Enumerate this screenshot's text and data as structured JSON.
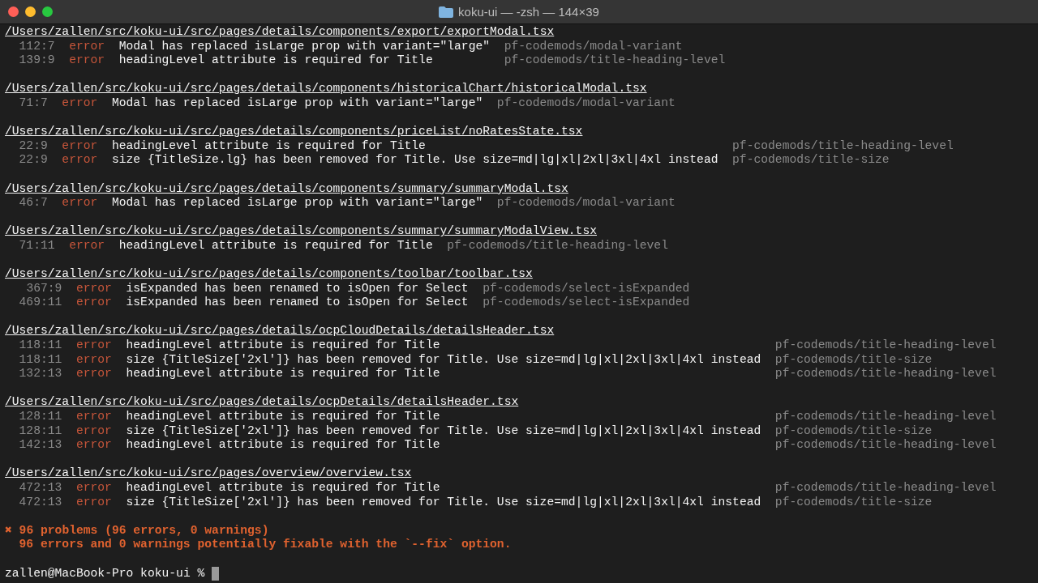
{
  "window": {
    "title": "koku-ui — -zsh — 144×39"
  },
  "files": [
    {
      "path": "/Users/zallen/src/koku-ui/src/pages/details/components/export/exportModal.tsx",
      "problems": [
        {
          "location": "112:7",
          "severity": "error",
          "message": "Modal has replaced isLarge prop with variant=\"large\"",
          "rule": "pf-codemods/modal-variant"
        },
        {
          "location": "139:9",
          "severity": "error",
          "message": "headingLevel attribute is required for Title",
          "rule": "pf-codemods/title-heading-level"
        }
      ]
    },
    {
      "path": "/Users/zallen/src/koku-ui/src/pages/details/components/historicalChart/historicalModal.tsx",
      "problems": [
        {
          "location": "71:7",
          "severity": "error",
          "message": "Modal has replaced isLarge prop with variant=\"large\"",
          "rule": "pf-codemods/modal-variant"
        }
      ]
    },
    {
      "path": "/Users/zallen/src/koku-ui/src/pages/details/components/priceList/noRatesState.tsx",
      "problems": [
        {
          "location": "22:9",
          "severity": "error",
          "message": "headingLevel attribute is required for Title",
          "rule": "pf-codemods/title-heading-level"
        },
        {
          "location": "22:9",
          "severity": "error",
          "message": "size {TitleSize.lg} has been removed for Title. Use size=md|lg|xl|2xl|3xl|4xl instead",
          "rule": "pf-codemods/title-size"
        }
      ]
    },
    {
      "path": "/Users/zallen/src/koku-ui/src/pages/details/components/summary/summaryModal.tsx",
      "problems": [
        {
          "location": "46:7",
          "severity": "error",
          "message": "Modal has replaced isLarge prop with variant=\"large\"",
          "rule": "pf-codemods/modal-variant"
        }
      ]
    },
    {
      "path": "/Users/zallen/src/koku-ui/src/pages/details/components/summary/summaryModalView.tsx",
      "problems": [
        {
          "location": "71:11",
          "severity": "error",
          "message": "headingLevel attribute is required for Title",
          "rule": "pf-codemods/title-heading-level"
        }
      ]
    },
    {
      "path": "/Users/zallen/src/koku-ui/src/pages/details/components/toolbar/toolbar.tsx",
      "problems": [
        {
          "location": "367:9",
          "severity": "error",
          "message": "isExpanded has been renamed to isOpen for Select",
          "rule": "pf-codemods/select-isExpanded"
        },
        {
          "location": "469:11",
          "severity": "error",
          "message": "isExpanded has been renamed to isOpen for Select",
          "rule": "pf-codemods/select-isExpanded"
        }
      ]
    },
    {
      "path": "/Users/zallen/src/koku-ui/src/pages/details/ocpCloudDetails/detailsHeader.tsx",
      "problems": [
        {
          "location": "118:11",
          "severity": "error",
          "message": "headingLevel attribute is required for Title",
          "rule": "pf-codemods/title-heading-level"
        },
        {
          "location": "118:11",
          "severity": "error",
          "message": "size {TitleSize['2xl']} has been removed for Title. Use size=md|lg|xl|2xl|3xl|4xl instead",
          "rule": "pf-codemods/title-size"
        },
        {
          "location": "132:13",
          "severity": "error",
          "message": "headingLevel attribute is required for Title",
          "rule": "pf-codemods/title-heading-level"
        }
      ]
    },
    {
      "path": "/Users/zallen/src/koku-ui/src/pages/details/ocpDetails/detailsHeader.tsx",
      "problems": [
        {
          "location": "128:11",
          "severity": "error",
          "message": "headingLevel attribute is required for Title",
          "rule": "pf-codemods/title-heading-level"
        },
        {
          "location": "128:11",
          "severity": "error",
          "message": "size {TitleSize['2xl']} has been removed for Title. Use size=md|lg|xl|2xl|3xl|4xl instead",
          "rule": "pf-codemods/title-size"
        },
        {
          "location": "142:13",
          "severity": "error",
          "message": "headingLevel attribute is required for Title",
          "rule": "pf-codemods/title-heading-level"
        }
      ]
    },
    {
      "path": "/Users/zallen/src/koku-ui/src/pages/overview/overview.tsx",
      "problems": [
        {
          "location": "472:13",
          "severity": "error",
          "message": "headingLevel attribute is required for Title",
          "rule": "pf-codemods/title-heading-level"
        },
        {
          "location": "472:13",
          "severity": "error",
          "message": "size {TitleSize['2xl']} has been removed for Title. Use size=md|lg|xl|2xl|3xl|4xl instead",
          "rule": "pf-codemods/title-size"
        }
      ]
    }
  ],
  "summary": {
    "problems": "✖ 96 problems (96 errors, 0 warnings)",
    "fixable": "96 errors and 0 warnings potentially fixable with the `--fix` option."
  },
  "prompt": {
    "text": "zallen@MacBook-Pro koku-ui %"
  }
}
